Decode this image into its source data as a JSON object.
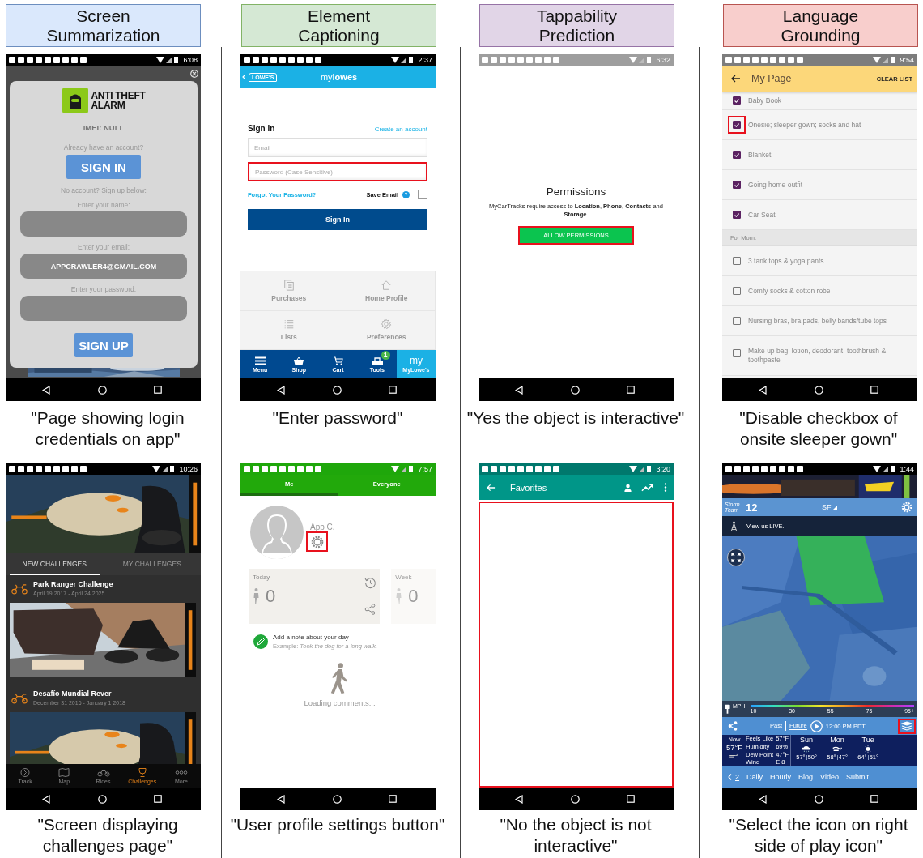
{
  "tasks": [
    {
      "title": "Screen Summarization",
      "color": "#dae8fc"
    },
    {
      "title": "Element Captioning",
      "color": "#d5e8d4"
    },
    {
      "title": "Tappability Prediction",
      "color": "#e1d5e7"
    },
    {
      "title": "Language Grounding",
      "color": "#f8cecc"
    }
  ],
  "examples": [
    {
      "screen": {
        "kind": "login_dialog",
        "time": "6:08",
        "app_name": [
          "ANTI THEFT",
          "ALARM"
        ],
        "imei": "IMEI: NULL",
        "account_prompt": "Already have an account?",
        "sign_in": "SIGN IN",
        "signup_prompt": "No account? Sign up below:",
        "fields": [
          {
            "label": "Enter your name:"
          },
          {
            "label": "Enter your email:",
            "value": "APPCRAWLER4@GMAIL.COM"
          },
          {
            "label": "Enter your password:"
          }
        ],
        "sign_up": "SIGN UP"
      },
      "caption": "\"Page showing login credentials on app\""
    },
    {
      "screen": {
        "kind": "store_sign_in",
        "time": "2:37",
        "logo": "LOWE'S",
        "title": "my**lowes**",
        "heading": "Sign In",
        "create_link": "Create an account",
        "fields": [
          {
            "placeholder": "Email",
            "highlighted": false
          },
          {
            "placeholder": "Password (Case Sensitive)",
            "highlighted": true
          }
        ],
        "forgot_link": "Forgot Your Password?",
        "save_email": {
          "label": "Save Email",
          "checked": false
        },
        "button": "Sign In",
        "tiles": [
          {
            "label": "Purchases",
            "kind": "receipts"
          },
          {
            "label": "Home Profile",
            "kind": "home"
          },
          {
            "label": "Lists",
            "kind": "list"
          },
          {
            "label": "Preferences",
            "kind": "gear"
          }
        ],
        "tabs": [
          {
            "label": "Menu",
            "kind": "menu",
            "selected": false
          },
          {
            "label": "Shop",
            "kind": "basket",
            "selected": false
          },
          {
            "label": "Cart",
            "kind": "cart",
            "selected": false
          },
          {
            "label": "Tools",
            "kind": "tools",
            "badge": "1",
            "selected": false
          },
          {
            "label": "MyLowe's",
            "kind": "text",
            "icon_text": "my",
            "selected": true
          }
        ]
      },
      "caption": "\"Enter password\""
    },
    {
      "screen": {
        "kind": "permissions",
        "time": "6:32",
        "title": "Permissions",
        "message": "MyCarTracks require access to **Location**, **Phone**, **Contacts** and **Storage**.",
        "button": {
          "label": "ALLOW PERMISSIONS",
          "highlighted": true
        }
      },
      "caption": "\"Yes the object is interactive\""
    },
    {
      "screen": {
        "kind": "checklist",
        "time": "9:54",
        "title": "My Page",
        "action": "CLEAR LIST",
        "items": [
          {
            "kind": "item",
            "label": "Baby Book",
            "checked": true,
            "highlighted": false
          },
          {
            "kind": "item",
            "label": "Onesie; sleeper gown; socks and hat",
            "checked": true,
            "highlighted": true
          },
          {
            "kind": "item",
            "label": "Blanket",
            "checked": true,
            "highlighted": false
          },
          {
            "kind": "item",
            "label": "Going home outfit",
            "checked": true,
            "highlighted": false
          },
          {
            "kind": "item",
            "label": "Car Seat",
            "checked": true,
            "highlighted": false
          },
          {
            "kind": "header",
            "label": "For Mom:"
          },
          {
            "kind": "item",
            "label": "3 tank tops & yoga pants",
            "checked": false,
            "highlighted": false
          },
          {
            "kind": "item",
            "label": "Comfy socks & cotton robe",
            "checked": false,
            "highlighted": false
          },
          {
            "kind": "item",
            "label": "Nursing bras, bra pads, belly bands/tube tops",
            "checked": false,
            "highlighted": false
          },
          {
            "kind": "item",
            "label": "Make up bag, lotion, deodorant, toothbrush & toothpaste",
            "checked": false,
            "highlighted": false
          }
        ]
      },
      "caption": "\"Disable checkbox of onsite sleeper gown\""
    },
    {
      "screen": {
        "kind": "challenges",
        "time": "10:26",
        "tabs": [
          {
            "label": "NEW CHALLENGES",
            "selected": true
          },
          {
            "label": "MY CHALLENGES",
            "selected": false
          }
        ],
        "challenges": [
          {
            "title": "Park Ranger Challenge",
            "dates": "April 19 2017 - April 24 2025"
          },
          {
            "title": "Desafío Mundial Rever",
            "dates": "December 31 2016 - January 1 2018"
          }
        ],
        "nav": [
          {
            "label": "Track",
            "kind": "track",
            "selected": false
          },
          {
            "label": "Map",
            "kind": "map",
            "selected": false
          },
          {
            "label": "Rides",
            "kind": "rides",
            "selected": false
          },
          {
            "label": "Challenges",
            "kind": "trophy",
            "selected": true
          },
          {
            "label": "More",
            "kind": "more",
            "selected": false
          }
        ]
      },
      "caption": "\"Screen displaying challenges page\""
    },
    {
      "screen": {
        "kind": "pedometer",
        "time": "7:57",
        "tabs": [
          {
            "label": "Me",
            "selected": true
          },
          {
            "label": "Everyone",
            "selected": false
          }
        ],
        "user_name": "App C.",
        "settings": {
          "highlighted": true
        },
        "cards": [
          {
            "label": "Today",
            "value": "0",
            "faded": false
          },
          {
            "label": "Week",
            "value": "0",
            "faded": true
          }
        ],
        "note_title": "Add a note about your day",
        "note_example": "Example: *Took the dog for a long walk.*",
        "loading": "Loading comments..."
      },
      "caption": "\"User profile settings button\""
    },
    {
      "screen": {
        "kind": "favorites",
        "time": "3:20",
        "title": "Favorites",
        "content": {
          "highlighted": true
        }
      },
      "caption": "\"No the object is not interactive\""
    },
    {
      "screen": {
        "kind": "weather",
        "time": "1:44",
        "logo_text": "Storm Team",
        "logo": "12",
        "location": "SF",
        "live": "View us LIVE.",
        "legend": {
          "unit": "MPH",
          "ticks": [
            "10",
            "30",
            "55",
            "75",
            "95+"
          ]
        },
        "modes": [
          {
            "label": "Past",
            "selected": false
          },
          {
            "label": "Future",
            "selected": true
          }
        ],
        "time_label": "12:00 PM PDT",
        "layers": {
          "highlighted": true
        },
        "now": {
          "label": "Now",
          "temp": "57°F"
        },
        "details": [
          {
            "label": "Feels Like",
            "value": "57°F"
          },
          {
            "label": "Humidity",
            "value": "69%"
          },
          {
            "label": "Dew Point",
            "value": "47°F"
          },
          {
            "label": "Wind",
            "value": "E 8"
          }
        ],
        "forecast": [
          {
            "day": "Sun",
            "kind": "rain",
            "high": "57°",
            "low": "50°"
          },
          {
            "day": "Mon",
            "kind": "wind",
            "high": "58°",
            "low": "47°"
          },
          {
            "day": "Tue",
            "kind": "sun",
            "high": "64°",
            "low": "51°"
          }
        ],
        "page": "2",
        "links": [
          "Daily",
          "Hourly",
          "Blog",
          "Video",
          "Submit"
        ]
      },
      "caption": "\"Select the icon on right side of play icon\""
    }
  ]
}
